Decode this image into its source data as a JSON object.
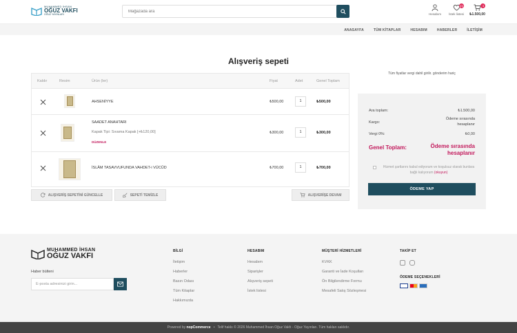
{
  "header": {
    "logo": {
      "line1": "MUHAMMED İHSAN",
      "line2": "OĞUZ VAKFI",
      "line3": "OĞUZ YAYINLARI"
    },
    "search_placeholder": "Mağazada ara",
    "account_label": "Hesabım",
    "wishlist_label": "İstek listesi",
    "wishlist_count": "(0)",
    "cart_count": "3",
    "cart_total": "₺1.500,00"
  },
  "nav": {
    "items": [
      "ANASAYFA",
      "TÜM KİTAPLAR",
      "HESABIM",
      "HABERLER",
      "İLETİŞİM"
    ]
  },
  "page_title": "Alışveriş sepeti",
  "cart": {
    "headers": {
      "remove": "Kaldır",
      "image": "Resim",
      "product": "Ürün (ler)",
      "price": "Fiyat",
      "qty": "Adet",
      "total": "Genel Toplam"
    },
    "items": [
      {
        "name": "AHSENİYYE",
        "attr": "",
        "edit": "",
        "price": "₺500,00",
        "qty": "1",
        "total": "₺500,00"
      },
      {
        "name": "SAADET ANAHTARI",
        "attr": "Kapak Tipi: Sıvama Kapak [+₺120,00]",
        "edit": "DÜZENLE",
        "price": "₺300,00",
        "qty": "1",
        "total": "₺300,00"
      },
      {
        "name": "İSLÂM TASAVVUFUNDA VAHDET-i VÜCÛD",
        "attr": "",
        "edit": "",
        "price": "₺700,00",
        "qty": "1",
        "total": "₺700,00"
      }
    ],
    "buttons": {
      "update": "ALIŞVERİŞ SEPETİNİ GÜNCELLE",
      "clear": "SEPETİ TEMİZLE",
      "continue": "ALIŞVERİŞE DEVAM"
    }
  },
  "summary": {
    "tax_note": "Tüm fiyatlar vergi dahil girilir. gönderim hariç",
    "subtotal_label": "Ara toplam:",
    "subtotal_value": "₺1.500,00",
    "shipping_label": "Kargo:",
    "shipping_value_1": "Ödeme sırasında",
    "shipping_value_2": "hesaplanır",
    "tax_label": "Vergi 0%:",
    "tax_value": "₺0,00",
    "grand_label": "Genel Toplam:",
    "grand_value_1": "Ödeme sırasında",
    "grand_value_2": "hesaplanır",
    "terms_text": "Hizmet şartlarını kabul ediyorum ve koşulsuz olarak bunlara bağlı kalıyorum",
    "terms_link": "(okuyun)",
    "checkout": "ÖDEME YAP"
  },
  "footer": {
    "logo": {
      "line1": "MUHAMMED İHSAN",
      "line2": "OĞUZ VAKFI"
    },
    "newsletter_title": "Haber bülteni",
    "newsletter_placeholder": "E-posta adresinizi girin...",
    "col_info": {
      "title": "BİLGİ",
      "items": [
        "İletişim",
        "Haberler",
        "Basın Odası",
        "Tüm Kitaplar",
        "Hakkımızda"
      ]
    },
    "col_account": {
      "title": "HESABIM",
      "items": [
        "Hesabım",
        "Siparişler",
        "Alışveriş sepeti",
        "İstek listesi"
      ]
    },
    "col_service": {
      "title": "MÜŞTERİ HİZMETLERİ",
      "items": [
        "KVKK",
        "Garanti ve İade Koşulları",
        "Ön Bilgilendirme Formu",
        "Mesafeli Satış Sözleşmesi"
      ]
    },
    "follow_title": "TAKİP ET",
    "payment_title": "ÖDEME SEÇENEKLERİ",
    "bottom_powered": "Powered by",
    "bottom_brand": "nopCommerce",
    "bottom_copy": "Telif hakkı © 2026 Muhammed İhsan Oğuz Vakfı - Oğuz Yayınları. Tüm hakları saklıdır."
  },
  "colors": {
    "primary": "#1f4e5f",
    "accent": "#c2185b",
    "badge": "#e02c5b"
  }
}
